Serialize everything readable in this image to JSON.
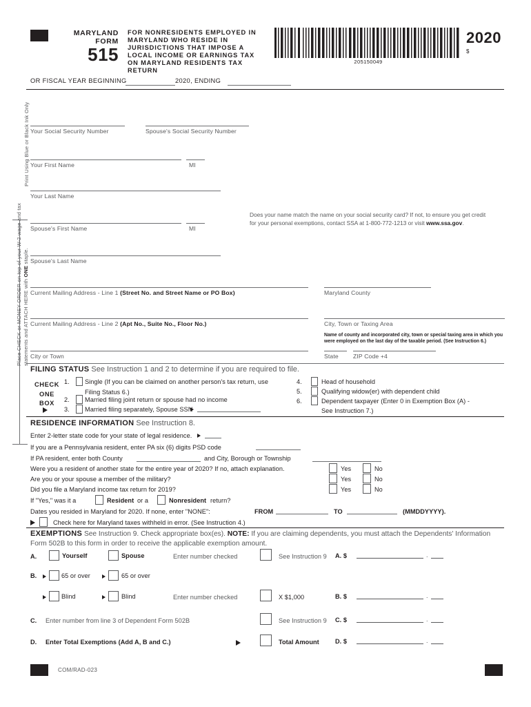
{
  "header": {
    "agency_line1": "MARYLAND",
    "agency_line2": "FORM",
    "form_number": "515",
    "form_title": "FOR NONRESIDENTS EMPLOYED IN MARYLAND WHO RESIDE IN JURISDICTIONS THAT IMPOSE A LOCAL INCOME OR EARNINGS TAX ON MARYLAND RESIDENTS TAX RETURN",
    "barcode_number": "205150049",
    "tax_year": "2020",
    "dollar_symbol": "$",
    "fiscal_label": "OR FISCAL YEAR BEGINNING",
    "fiscal_mid": "2020, ENDING"
  },
  "side_notes": {
    "ink": "Print Using Blue or Black Ink Only",
    "attach_pre": "Place CHECK or MONEY ORDER on top of your W-2 wage and tax statements and ATTACH HERE with ",
    "attach_bold": "ONE",
    "attach_post": " staple."
  },
  "identity": {
    "your_ssn": "Your Social Security Number",
    "spouse_ssn": "Spouse's Social Security Number",
    "your_first_name": "Your First Name",
    "mi": "MI",
    "your_last_name": "Your Last Name",
    "spouse_first_name": "Spouse's First Name",
    "spouse_mi": "MI",
    "spouse_last_name": "Spouse's Last Name",
    "ssa_note_pre": "Does your name match the name on your social security card? If not, to ensure you get credit for your personal exemptions, contact SSA at 1-800-772-1213 or visit ",
    "ssa_note_bold": "www.ssa.gov",
    "ssa_note_post": "."
  },
  "address": {
    "line1_plain": "Current Mailing Address - Line 1 ",
    "line1_bold": "(Street No. and Street Name or PO Box)",
    "line2_plain": "Current Mailing Address - Line 2  ",
    "line2_bold": "(Apt No., Suite No., Floor No.)",
    "city_or_town": "City or Town",
    "maryland_county": "Maryland County",
    "city_town_taxing": "City, Town or Taxing Area",
    "county_help": "Name of county and incorporated city, town or special taxing area in which you were employed on the last day of the taxable period. (See Instruction 6.)",
    "state": "State",
    "zip": "ZIP Code +4"
  },
  "filing_status": {
    "heading_bold": "FILING STATUS",
    "heading_rest": " See Instruction 1 and 2 to determine if you are required to file.",
    "check_one_line1": "CHECK",
    "check_one_line2": "ONE",
    "check_one_line3": "BOX",
    "options": [
      {
        "num": "1.",
        "label": "Single (If you can be claimed on another person's tax return, use",
        "cont": "Filing Status 6.)"
      },
      {
        "num": "2.",
        "label": "Married filing joint return or spouse had no income",
        "cont": ""
      },
      {
        "num": "3.",
        "label": "Married filing separately, Spouse SSN",
        "cont": ""
      },
      {
        "num": "4.",
        "label": "Head of household",
        "cont": ""
      },
      {
        "num": "5.",
        "label": "Qualifying widow(er) with dependent child",
        "cont": ""
      },
      {
        "num": "6.",
        "label": "Dependent taxpayer (Enter 0 in Exemption Box (A) -",
        "cont": "See Instruction 7.)"
      }
    ]
  },
  "residence": {
    "heading_bold": "RESIDENCE INFORMATION",
    "heading_rest": " See Instruction 8.",
    "state_code_line": "Enter 2-letter state code for your state of legal residence.",
    "psd_line": "If you are a Pennsylvania resident, enter PA six (6) digits PSD code",
    "pa_county_pre": "If PA resident, enter both County",
    "pa_county_mid": "and City, Borough or Township",
    "q_other_state": "Were you a resident of another state for the entire year of 2020? If no, attach explanation.",
    "q_military": "Are you or your spouse a member of the military?",
    "q_md_return": "Did you file a Maryland income tax return for 2019?",
    "yes": "Yes",
    "no": "No",
    "if_yes_pre": "If \"Yes,\" was it a",
    "resident": "Resident",
    "or_a": "or a",
    "nonresident": "Nonresident",
    "return_q": "return?",
    "dates_pre": "Dates you resided in Maryland for 2020. If none, enter \"NONE\":",
    "dates_from": "FROM",
    "dates_to": "TO",
    "dates_format": "(MMDDYYYY).",
    "withheld_error": "Check here for Maryland taxes withheld in error. (See Instruction 4.)"
  },
  "exemptions": {
    "heading_bold": "EXEMPTIONS",
    "heading_mid": " See Instruction 9. Check appropriate box(es). ",
    "heading_note_bold": "NOTE:",
    "heading_rest": " If you are claiming dependents, you must attach the Dependents' Information Form 502B to this form in order to receive the applicable exemption amount.",
    "row_a": {
      "letter": "A.",
      "yourself": "Yourself",
      "spouse": "Spouse",
      "enter_number": "Enter number checked",
      "instruction": "See Instruction 9",
      "amount_label": "A. $"
    },
    "row_b": {
      "letter": "B.",
      "age_self": "65 or over",
      "age_spouse": "65 or over",
      "blind_self": "Blind",
      "blind_spouse": "Blind",
      "enter_number": "Enter number checked",
      "multiplier": "X  $1,000",
      "amount_label": "B. $"
    },
    "row_c": {
      "letter": "C.",
      "label": "Enter number from line 3 of Dependent Form 502B",
      "instruction": "See Instruction 9",
      "amount_label": "C. $"
    },
    "row_d": {
      "letter": "D.",
      "label": "Enter Total Exemptions (Add A, B and C.)",
      "total": "Total Amount",
      "amount_label": "D. $"
    }
  },
  "footer": {
    "code": "COM/RAD-023"
  },
  "colors": {
    "ink": "#231f20",
    "gray": "#58595b",
    "rule": "#6d6e71"
  }
}
